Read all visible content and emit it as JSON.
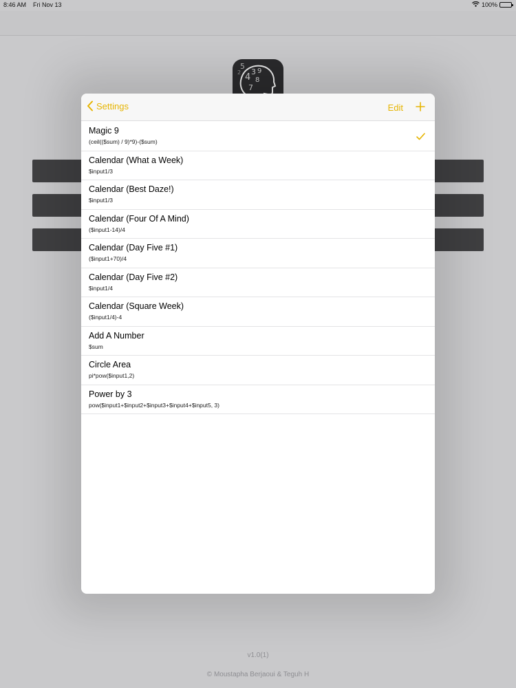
{
  "status_bar": {
    "time": "8:46 AM",
    "date": "Fri Nov 13",
    "battery": "100%"
  },
  "background": {
    "version": "v1.0(1)",
    "credit": "© Moustapha Berjaoui & Teguh H",
    "logo_digits": [
      "5",
      "3",
      "9",
      "4",
      "8",
      "7",
      "2"
    ]
  },
  "sheet": {
    "back_label": "Settings",
    "edit_label": "Edit",
    "accent_color": "#e6b400",
    "items": [
      {
        "title": "Magic 9",
        "formula": "(ceil(($sum) / 9)*9)-($sum)",
        "selected": true
      },
      {
        "title": "Calendar (What a Week)",
        "formula": "$input1/3",
        "selected": false
      },
      {
        "title": "Calendar (Best Daze!)",
        "formula": "$input1/3",
        "selected": false
      },
      {
        "title": "Calendar (Four Of A Mind)",
        "formula": "($input1-14)/4",
        "selected": false
      },
      {
        "title": "Calendar (Day Five #1)",
        "formula": "($input1+70)/4",
        "selected": false
      },
      {
        "title": "Calendar (Day Five #2)",
        "formula": "$input1/4",
        "selected": false
      },
      {
        "title": "Calendar (Square Week)",
        "formula": "($input1/4)-4",
        "selected": false
      },
      {
        "title": "Add A Number",
        "formula": "$sum",
        "selected": false
      },
      {
        "title": "Circle Area",
        "formula": "pi*pow($input1,2)",
        "selected": false
      },
      {
        "title": "Power by 3",
        "formula": "pow($input1+$input2+$input3+$input4+$input5, 3)",
        "selected": false
      }
    ]
  }
}
